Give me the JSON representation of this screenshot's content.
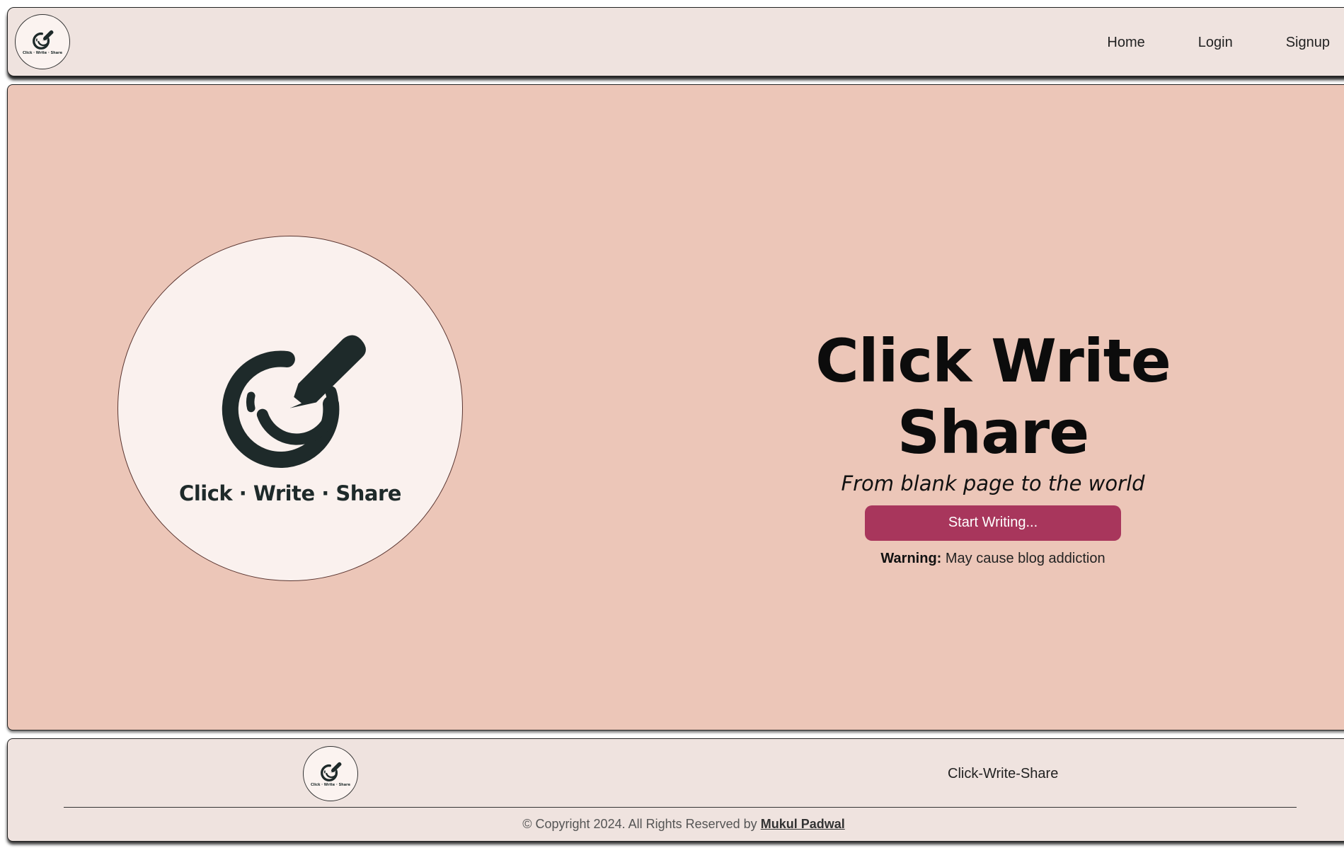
{
  "header": {
    "logo_text": "Click · Write · Share",
    "nav": [
      {
        "label": "Home"
      },
      {
        "label": "Login"
      },
      {
        "label": "Signup"
      }
    ]
  },
  "hero": {
    "logo_text": "Click · Write · Share",
    "title": "Click Write Share",
    "tagline": "From blank page to the world",
    "cta_label": "Start Writing...",
    "warning_label": "Warning:",
    "warning_text": "May cause blog addiction"
  },
  "footer": {
    "logo_text": "Click · Write · Share",
    "brand": "Click-Write-Share",
    "copyright_text": "© Copyright 2024. All Rights Reserved by",
    "author": "Mukul Padwal"
  },
  "colors": {
    "header_bg": "#efe3df",
    "hero_bg": "#ecc6b8",
    "cta_bg": "#a8365c",
    "logo_dark": "#1e2a2a"
  },
  "icons": {
    "logo": "pencil-swirl-icon"
  }
}
